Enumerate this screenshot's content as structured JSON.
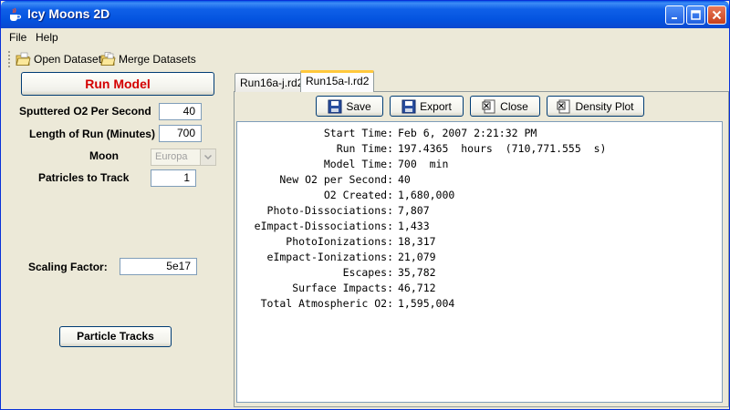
{
  "window": {
    "title": "Icy Moons 2D"
  },
  "menu": [
    "File",
    "Help"
  ],
  "toolbar": {
    "open_dataset": "Open Dataset",
    "merge_datasets": "Merge Datasets"
  },
  "left": {
    "run_model": "Run Model",
    "sputtered_label": "Sputtered O2 Per Second",
    "sputtered_value": "40",
    "length_label": "Length of Run (Minutes)",
    "length_value": "700",
    "moon_label": "Moon",
    "moon_value": "Europa",
    "particles_label": "Patricles to Track",
    "particles_value": "1",
    "scaling_label": "Scaling Factor:",
    "scaling_value": "5e17",
    "particle_tracks": "Particle Tracks"
  },
  "tabs": [
    {
      "label": "Run16a-j.rd2",
      "active": false
    },
    {
      "label": "Run15a-l.rd2",
      "active": true
    }
  ],
  "panel_buttons": {
    "save": "Save",
    "export": "Export",
    "close": "Close",
    "density_plot": "Density Plot"
  },
  "results": [
    {
      "key": "Start Time:",
      "value": "Feb 6, 2007 2:21:32 PM"
    },
    {
      "key": "Run Time:",
      "value": "197.4365  hours  (710,771.555  s)"
    },
    {
      "key": "Model Time:",
      "value": "700  min"
    },
    {
      "key": "New O2 per Second:",
      "value": "40"
    },
    {
      "key": "O2 Created:",
      "value": "1,680,000"
    },
    {
      "key": "Photo-Dissociations:",
      "value": "7,807"
    },
    {
      "key": "eImpact-Dissociations:",
      "value": "1,433"
    },
    {
      "key": "PhotoIonizations:",
      "value": "18,317"
    },
    {
      "key": "eImpact-Ionizations:",
      "value": "21,079"
    },
    {
      "key": "Escapes:",
      "value": "35,782"
    },
    {
      "key": "Surface Impacts:",
      "value": "46,712"
    },
    {
      "key": "Total Atmospheric O2:",
      "value": "1,595,004"
    }
  ],
  "colors": {
    "title_bar": "#0453df",
    "run_model_text": "#d40000",
    "active_tab_accent": "#ffc83c"
  }
}
